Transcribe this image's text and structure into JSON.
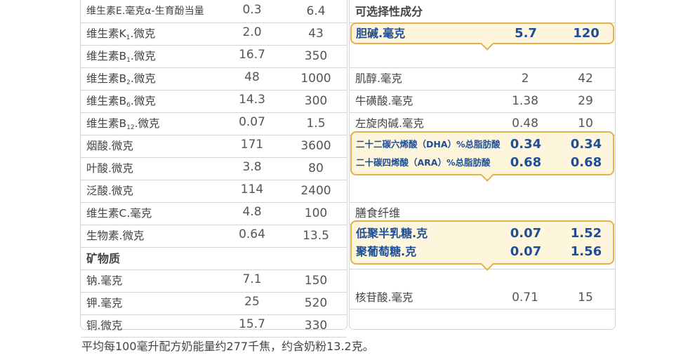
{
  "left_rows": [
    {
      "name": "维生素E.毫克α-生育酚当量",
      "v1": "0.3",
      "v2": "6.4"
    },
    {
      "name": "维生素K",
      "sub": "1",
      "unit": ".微克",
      "v1": "2.0",
      "v2": "43"
    },
    {
      "name": "维生素B",
      "sub": "1",
      "unit": ".微克",
      "v1": "16.7",
      "v2": "350"
    },
    {
      "name": "维生素B",
      "sub": "2",
      "unit": ".微克",
      "v1": "48",
      "v2": "1000"
    },
    {
      "name": "维生素B",
      "sub": "6",
      "unit": ".微克",
      "v1": "14.3",
      "v2": "300"
    },
    {
      "name": "维生素B",
      "sub": "12",
      "unit": ".微克",
      "v1": "0.07",
      "v2": "1.5"
    },
    {
      "name": "烟酸.微克",
      "v1": "171",
      "v2": "3600"
    },
    {
      "name": "叶酸.微克",
      "v1": "3.8",
      "v2": "80"
    },
    {
      "name": "泛酸.微克",
      "v1": "114",
      "v2": "2400"
    },
    {
      "name": "维生素C.毫克",
      "v1": "4.8",
      "v2": "100"
    },
    {
      "name": "生物素.微克",
      "v1": "0.64",
      "v2": "13.5"
    },
    {
      "section": "矿物质"
    },
    {
      "name": "钠.毫克",
      "v1": "7.1",
      "v2": "150"
    },
    {
      "name": "钾.毫克",
      "v1": "25",
      "v2": "520"
    },
    {
      "name": "铜.微克",
      "v1": "15.7",
      "v2": "330"
    }
  ],
  "right": {
    "optional_header": "可选择性成分",
    "choline": {
      "name": "胆碱.毫克",
      "v1": "5.7",
      "v2": "120"
    },
    "inositol": {
      "name": "肌醇.毫克",
      "v1": "2",
      "v2": "42"
    },
    "taurine": {
      "name": "牛磺酸.毫克",
      "v1": "1.38",
      "v2": "29"
    },
    "carnitine": {
      "name": "左旋肉碱.毫克",
      "v1": "0.48",
      "v2": "10"
    },
    "dha": {
      "name": "二十二碳六烯酸（DHA）%总脂肪酸",
      "v1": "0.34",
      "v2": "0.34"
    },
    "ara": {
      "name": "二十碳四烯酸（ARA）%总脂肪酸",
      "v1": "0.68",
      "v2": "0.68"
    },
    "fiber_header": "膳食纤维",
    "gos": {
      "name": "低聚半乳糖.克",
      "v1": "0.07",
      "v2": "1.52"
    },
    "pdx": {
      "name": "聚葡萄糖.克",
      "v1": "0.07",
      "v2": "1.56"
    },
    "nucleotide": {
      "name": "核苷酸.毫克",
      "v1": "0.71",
      "v2": "15"
    }
  },
  "footnote": "平均每100毫升配方奶能量约277千焦，约含奶粉13.2克。",
  "colors": {
    "highlight_border": "#e3b04b",
    "highlight_fill": "#fdf6dc",
    "highlight_text": "#1f4e96",
    "grid": "#d4d4d4"
  }
}
